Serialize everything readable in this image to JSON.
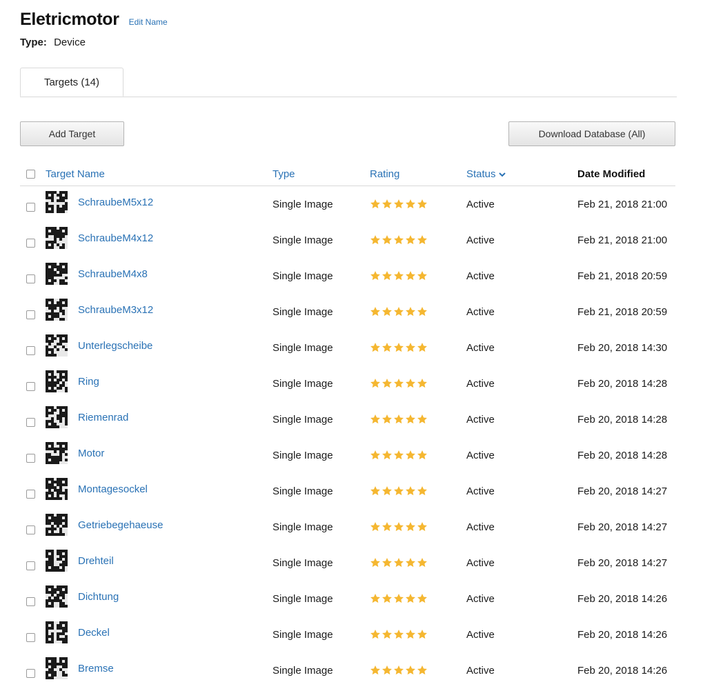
{
  "header": {
    "title": "Eletricmotor",
    "edit_label": "Edit Name",
    "type_label": "Type:",
    "type_value": "Device"
  },
  "tabs": [
    {
      "label": "Targets (14)",
      "active": true
    }
  ],
  "toolbar": {
    "add_label": "Add Target",
    "download_label": "Download Database (All)"
  },
  "table": {
    "columns": {
      "name": "Target Name",
      "type": "Type",
      "rating": "Rating",
      "status": "Status",
      "date": "Date Modified"
    },
    "rows": [
      {
        "name": "SchraubeM5x12",
        "type": "Single Image",
        "rating": 5,
        "status": "Active",
        "date": "Feb 21, 2018 21:00"
      },
      {
        "name": "SchraubeM4x12",
        "type": "Single Image",
        "rating": 5,
        "status": "Active",
        "date": "Feb 21, 2018 21:00"
      },
      {
        "name": "SchraubeM4x8",
        "type": "Single Image",
        "rating": 5,
        "status": "Active",
        "date": "Feb 21, 2018 20:59"
      },
      {
        "name": "SchraubeM3x12",
        "type": "Single Image",
        "rating": 5,
        "status": "Active",
        "date": "Feb 21, 2018 20:59"
      },
      {
        "name": "Unterlegscheibe",
        "type": "Single Image",
        "rating": 5,
        "status": "Active",
        "date": "Feb 20, 2018 14:30"
      },
      {
        "name": "Ring",
        "type": "Single Image",
        "rating": 5,
        "status": "Active",
        "date": "Feb 20, 2018 14:28"
      },
      {
        "name": "Riemenrad",
        "type": "Single Image",
        "rating": 5,
        "status": "Active",
        "date": "Feb 20, 2018 14:28"
      },
      {
        "name": "Motor",
        "type": "Single Image",
        "rating": 5,
        "status": "Active",
        "date": "Feb 20, 2018 14:28"
      },
      {
        "name": "Montagesockel",
        "type": "Single Image",
        "rating": 5,
        "status": "Active",
        "date": "Feb 20, 2018 14:27"
      },
      {
        "name": "Getriebegehaeuse",
        "type": "Single Image",
        "rating": 5,
        "status": "Active",
        "date": "Feb 20, 2018 14:27"
      },
      {
        "name": "Drehteil",
        "type": "Single Image",
        "rating": 5,
        "status": "Active",
        "date": "Feb 20, 2018 14:27"
      },
      {
        "name": "Dichtung",
        "type": "Single Image",
        "rating": 5,
        "status": "Active",
        "date": "Feb 20, 2018 14:26"
      },
      {
        "name": "Deckel",
        "type": "Single Image",
        "rating": 5,
        "status": "Active",
        "date": "Feb 20, 2018 14:26"
      },
      {
        "name": "Bremse",
        "type": "Single Image",
        "rating": 5,
        "status": "Active",
        "date": "Feb 20, 2018 14:26"
      }
    ]
  },
  "colors": {
    "link": "#2a72b5",
    "star": "#f5b731",
    "border": "#d9d9d9"
  },
  "icons": {
    "thumbnail": "qr-target-thumbnail-icon",
    "star": "star-icon",
    "sort": "chevron-down-icon"
  }
}
